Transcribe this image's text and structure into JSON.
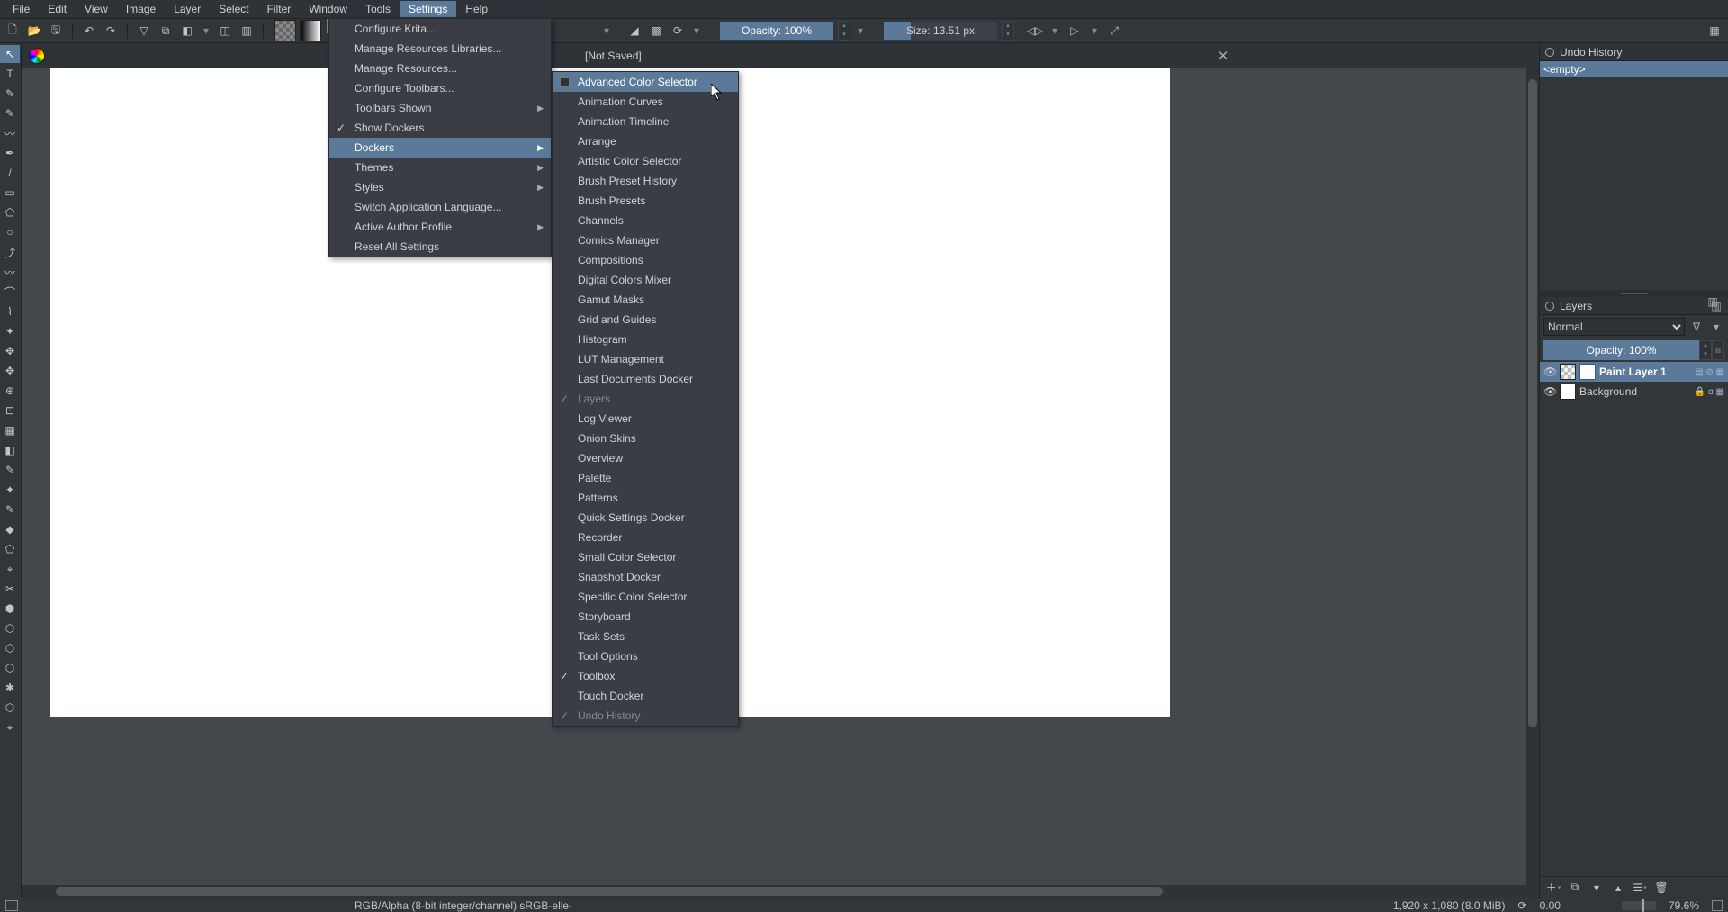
{
  "menubar": [
    "File",
    "Edit",
    "View",
    "Image",
    "Layer",
    "Select",
    "Filter",
    "Window",
    "Tools",
    "Settings",
    "Help"
  ],
  "menubar_active_index": 9,
  "toolbar": {
    "opacity_label": "Opacity: 100%",
    "size_label": "Size: 13.51 px"
  },
  "document": {
    "tab_title": "[Not Saved]"
  },
  "settings_menu": [
    {
      "label": "Configure Krita...",
      "submenu": false,
      "check": false
    },
    {
      "label": "Manage Resources Libraries...",
      "submenu": false,
      "check": false
    },
    {
      "label": "Manage Resources...",
      "submenu": false,
      "check": false
    },
    {
      "label": "Configure Toolbars...",
      "submenu": false,
      "check": false
    },
    {
      "label": "Toolbars Shown",
      "submenu": true,
      "check": false
    },
    {
      "label": "Show Dockers",
      "submenu": false,
      "check": true
    },
    {
      "label": "Dockers",
      "submenu": true,
      "check": false,
      "highlight": true
    },
    {
      "label": "Themes",
      "submenu": true,
      "check": false
    },
    {
      "label": "Styles",
      "submenu": true,
      "check": false
    },
    {
      "label": "Switch Application Language...",
      "submenu": false,
      "check": false
    },
    {
      "label": "Active Author Profile",
      "submenu": true,
      "check": false
    },
    {
      "label": "Reset All Settings",
      "submenu": false,
      "check": false
    }
  ],
  "dockers_menu": [
    {
      "label": "Advanced Color Selector",
      "check": false,
      "highlight": true,
      "checkbox": true
    },
    {
      "label": "Animation Curves",
      "check": false
    },
    {
      "label": "Animation Timeline",
      "check": false
    },
    {
      "label": "Arrange",
      "check": false
    },
    {
      "label": "Artistic Color Selector",
      "check": false
    },
    {
      "label": "Brush Preset History",
      "check": false
    },
    {
      "label": "Brush Presets",
      "check": false
    },
    {
      "label": "Channels",
      "check": false
    },
    {
      "label": "Comics Manager",
      "check": false
    },
    {
      "label": "Compositions",
      "check": false
    },
    {
      "label": "Digital Colors Mixer",
      "check": false
    },
    {
      "label": "Gamut Masks",
      "check": false
    },
    {
      "label": "Grid and Guides",
      "check": false
    },
    {
      "label": "Histogram",
      "check": false
    },
    {
      "label": "LUT Management",
      "check": false
    },
    {
      "label": "Last Documents Docker",
      "check": false
    },
    {
      "label": "Layers",
      "check": true,
      "dimmed": true
    },
    {
      "label": "Log Viewer",
      "check": false
    },
    {
      "label": "Onion Skins",
      "check": false
    },
    {
      "label": "Overview",
      "check": false
    },
    {
      "label": "Palette",
      "check": false
    },
    {
      "label": "Patterns",
      "check": false
    },
    {
      "label": "Quick Settings Docker",
      "check": false
    },
    {
      "label": "Recorder",
      "check": false
    },
    {
      "label": "Small Color Selector",
      "check": false
    },
    {
      "label": "Snapshot Docker",
      "check": false
    },
    {
      "label": "Specific Color Selector",
      "check": false
    },
    {
      "label": "Storyboard",
      "check": false
    },
    {
      "label": "Task Sets",
      "check": false
    },
    {
      "label": "Tool Options",
      "check": false
    },
    {
      "label": "Toolbox",
      "check": true
    },
    {
      "label": "Touch Docker",
      "check": false
    },
    {
      "label": "Undo History",
      "check": true,
      "dimmed": true
    }
  ],
  "undo_history": {
    "title": "Undo History",
    "entry": "<empty>"
  },
  "layers_panel": {
    "title": "Layers",
    "blend_mode": "Normal",
    "opacity_label": "Opacity:  100%",
    "layers": [
      {
        "name": "Paint Layer 1",
        "selected": true
      },
      {
        "name": "Background",
        "selected": false
      }
    ]
  },
  "status_bar": {
    "color_info": "RGB/Alpha (8-bit integer/channel)  sRGB-elle-",
    "dimensions": "1,920 x 1,080 (8.0 MiB)",
    "angle": "0.00",
    "zoom": "79.6%"
  },
  "tool_icons": [
    "↖",
    "T",
    "✎",
    "✎",
    "〰",
    "✒",
    "/",
    "▭",
    "⬠",
    "○",
    "⤴",
    "〰",
    "⌒",
    "⌇",
    "✦",
    "✥",
    "✥",
    "⊕",
    "⊡",
    "▦",
    "◧",
    "✎",
    "✦",
    "✎",
    "◆",
    "⬠",
    "⌖",
    "✂",
    "⬢",
    "⬡",
    "⬡",
    "⬡",
    "✱",
    "⬡",
    "⌖"
  ],
  "tool_names": [
    "move-tool",
    "text-tool",
    "freehand-select",
    "edit-shapes",
    "calligraphy",
    "pencil",
    "line",
    "rectangle",
    "polygon",
    "ellipse",
    "bezier",
    "polyline",
    "freehand-path",
    "dynamic-brush",
    "multi-brush",
    "transform",
    "move",
    "crop",
    "fill",
    "gradient",
    "pattern-edit",
    "color-picker",
    "smart-patch",
    "assistant",
    "measure",
    "reference",
    "pan",
    "zoom",
    "rect-select",
    "ellipse-select",
    "poly-select",
    "free-select",
    "contig-select",
    "similar-select",
    "magnetic-select"
  ]
}
